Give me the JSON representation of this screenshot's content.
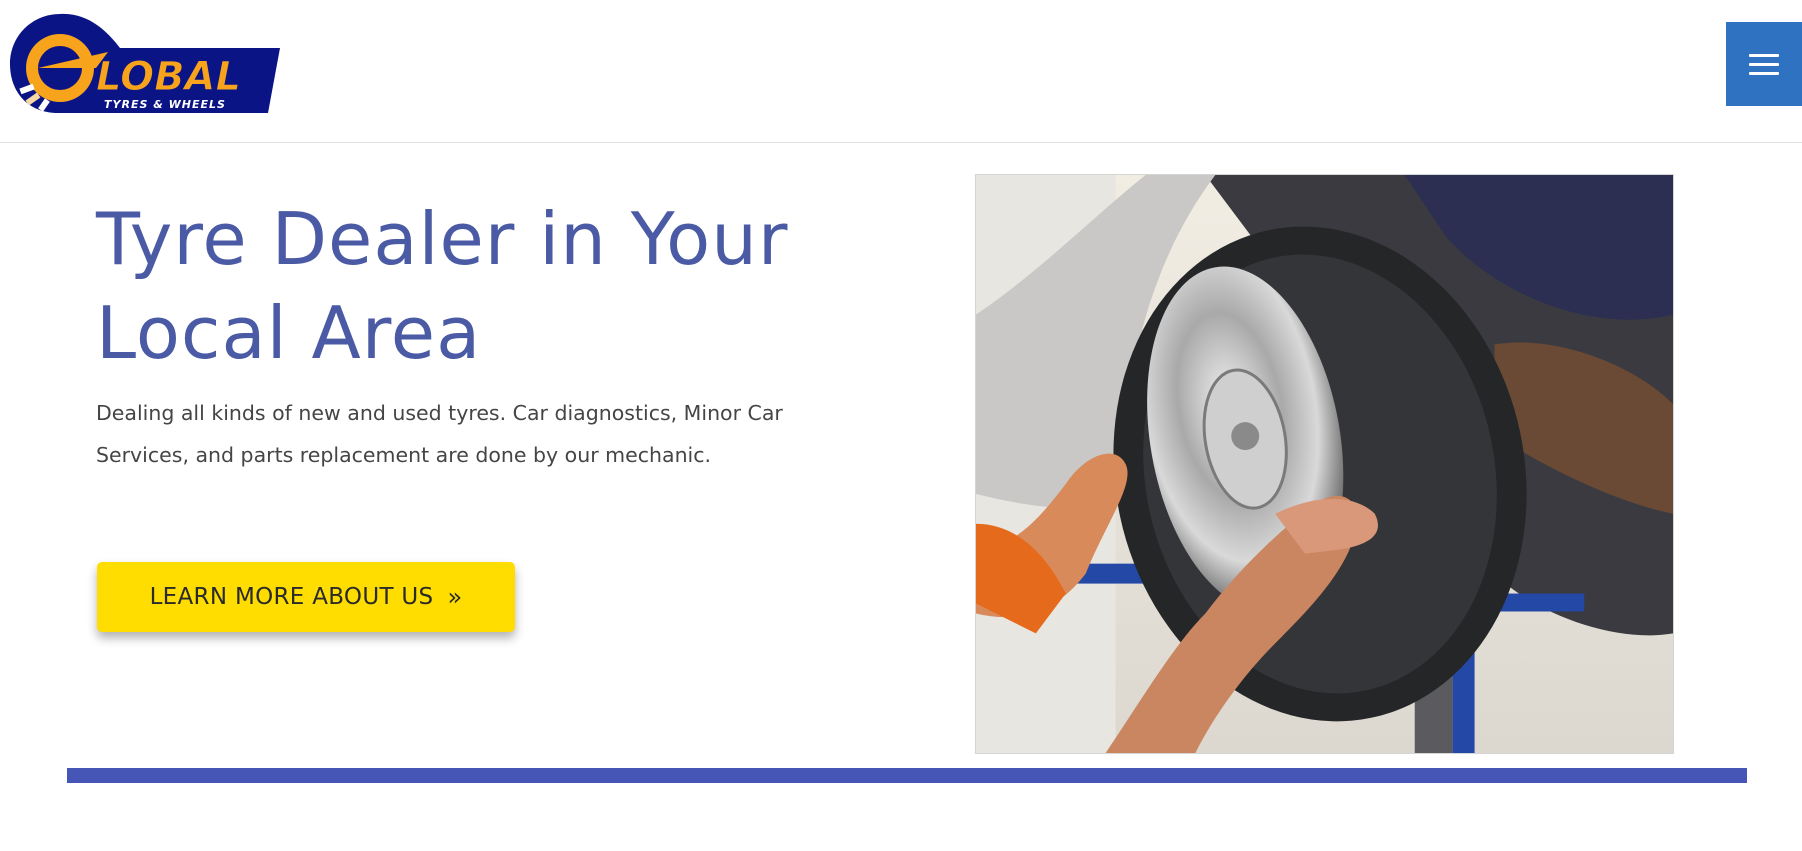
{
  "header": {
    "logo": {
      "wordmark": "LOBAL",
      "tagline": "TYRES & WHEELS"
    },
    "menu_icon": "hamburger-menu-icon"
  },
  "hero": {
    "title": "Tyre Dealer in Your Local Area",
    "description": "Dealing all kinds of new and used tyres. Car diagnostics, Minor Car Services, and parts replacement are done by our mechanic.",
    "cta": {
      "label": "LEARN MORE ABOUT US",
      "icon": "double-chevron-right-icon",
      "glyph": "»"
    },
    "image_alt": "Mechanic fitting a tyre with a chrome rim onto a car on a lift"
  },
  "colors": {
    "brand_blue": "#4b5aa4",
    "accent_bar": "#4656b7",
    "menu_button": "#2f72c2",
    "cta_yellow": "#ffdd00",
    "logo_navy": "#0b1484",
    "logo_orange": "#f7a31c"
  }
}
